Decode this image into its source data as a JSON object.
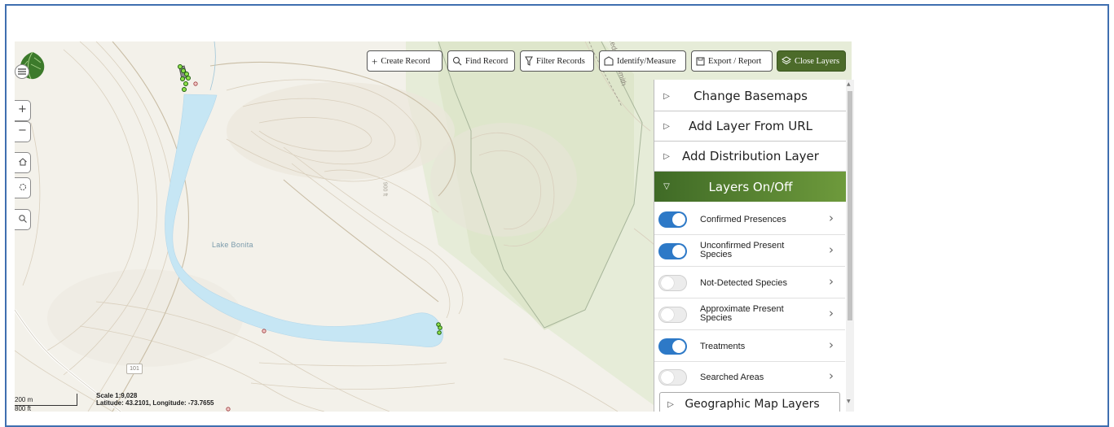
{
  "toolbar": {
    "create_record": "Create Record",
    "find_record": "Find Record",
    "filter_records": "Filter Records",
    "identify_measure": "Identify/Measure",
    "export_report": "Export / Report",
    "close_layers": "Close Layers"
  },
  "panel": {
    "sections": [
      {
        "label": "Change Basemaps",
        "expanded": false
      },
      {
        "label": "Add Layer From URL",
        "expanded": false
      },
      {
        "label": "Add Distribution Layer",
        "expanded": false
      },
      {
        "label": "Layers On/Off",
        "expanded": true
      }
    ],
    "layers": [
      {
        "label": "Confirmed Presences",
        "on": true
      },
      {
        "label": "Unconfirmed Present Species",
        "on": true
      },
      {
        "label": "Not-Detected Species",
        "on": false
      },
      {
        "label": "Approximate Present Species",
        "on": false
      },
      {
        "label": "Treatments",
        "on": true
      },
      {
        "label": "Searched Areas",
        "on": false
      }
    ],
    "partial_section": "Geographic Map Layers"
  },
  "map": {
    "lake_label": "Lake Bonita",
    "elevation_label": "900 ft",
    "road_label": "Ledgeau Smith",
    "route_shield": "101",
    "scale_text": "Scale 1:9,028",
    "coordinates": "Latitude: 43.2101, Longitude: -73.7655",
    "scale_bar_m": "200 m",
    "scale_bar_ft": "800 ft"
  },
  "colors": {
    "accent_green": "#4c6b2a",
    "toggle_on": "#2d79c7",
    "lake": "#c6e6f4",
    "frame": "#3f6fb0"
  }
}
